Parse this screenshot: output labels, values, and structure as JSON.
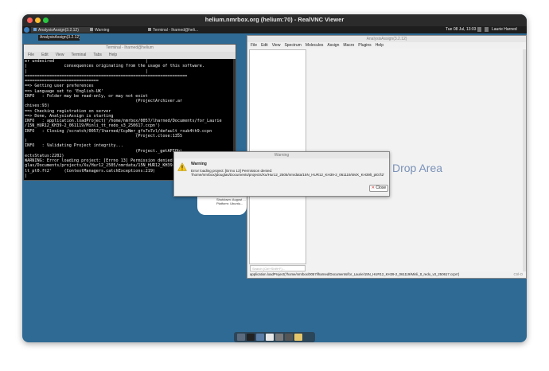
{
  "window": {
    "title": "helium.nmrbox.org (helium:70) - RealVNC Viewer"
  },
  "panel": {
    "tasks": [
      "AnalysisAssign(3.2.12)",
      "Warning",
      "Terminal - lharned@heli..."
    ],
    "clock": "Tue 08 Jul, 13:03",
    "user": "Laurie Harned"
  },
  "subbar": {
    "active_task": "AnalysisAssign(3.2.12)"
  },
  "terminal": {
    "title": "Terminal - lharned@helium",
    "menu": [
      "File",
      "Edit",
      "View",
      "Terminal",
      "Tabs",
      "Help"
    ],
    "lines": [
      "er undesired                                     |",
      "|               consequences originating from the usage of this software.",
      "|                                                |",
      "==================================================================",
      "==============================",
      "==> Getting user preferences",
      "==> Language set to 'English-UK'",
      "INFO   : Folder may be read-only, or may not exist",
      "                                             (ProjectArchiver.ar",
      "chives:93)",
      "==> Checking registration on server",
      "==> Done, AnalysisAssign is starting",
      "INFO   : application.loadProject('/home/nmrbox/0057/lharned/Documents/for_Laurie",
      "/15N_HUR12_KH39-2_061119/Minli_tt_redo_v3_250617.ccpn')",
      "INFO   : Closing /scratch/0057/lharned/CcpNmr_gfs7o7zl/default_rsub4th9.ccpn",
      "                                             (Project.close:1355",
      ")",
      "INFO   : Validating Project integrity...",
      "                                             (Project._getAPIObj",
      "ectsStatus:2202)",
      "WARNING: Error loading project: [Errno 13] Permission denied: '/home/nmrbox/jdou",
      "glas/Documents/projects/Xu/Hur12_2505/nmrdata/15N_HUR12_KH39-2_061119/4MX_KH39",
      "lt_pt0.ft2'     (ContextManagers.catchExceptions:219)",
      "|"
    ]
  },
  "analysis": {
    "title": "AnalysisAssign(3.2.12)",
    "menu": [
      "File",
      "Edit",
      "View",
      "Spectrum",
      "Molecules",
      "Assign",
      "Macro",
      "Plugins",
      "Help"
    ],
    "search_placeholder": "Search (Ctrl+Shift+F)...",
    "drop_area": "Drop Area",
    "status": "application.loadProject('/home/nmrbox/0057/lharned/Documents/for_Laurie/15N_HUR12_KH39-2_061119/Minli_tt_redo_v3_250617.ccpn')",
    "status_shortcut": "Ctrl-O"
  },
  "about": {
    "lines": [
      "Version:   2025.2...",
      "Shutdown:  August ...",
      "Platform:  Ubuntu..."
    ]
  },
  "dialog": {
    "title": "Warning",
    "heading": "Warning",
    "message": "Error loading project: [Errno 13] Permission denied: '/home/nmrbox/jdouglas/Documents/projects/Xu/Hur12_2505/nmrdata/15N_HUR12_KH39-2_061119/4MX_KH39lt_pt0.ft2'",
    "close_label": "Close"
  },
  "colors": {
    "desktop": "#2f6a94",
    "drop_area_text": "#7a92b8",
    "close_dot": "#ff5f57",
    "minimize_dot": "#febc2e",
    "zoom_dot": "#28c840"
  }
}
